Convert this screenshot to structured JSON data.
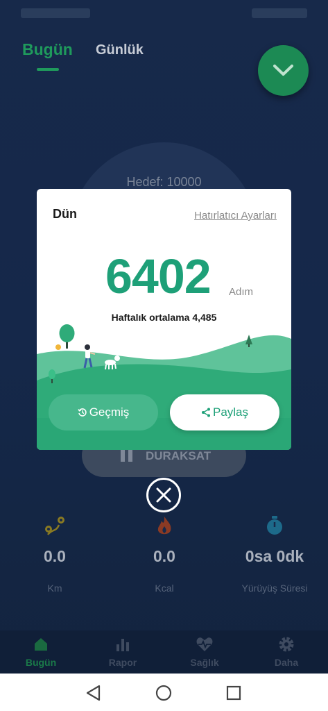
{
  "top_tabs": {
    "today": "Bugün",
    "daily": "Günlük"
  },
  "goal": {
    "label": "Hedef: 10000"
  },
  "pause": {
    "label": "DURAKSAT"
  },
  "stats": [
    {
      "value": "0.0",
      "label": "Km",
      "icon": "route-icon"
    },
    {
      "value": "0.0",
      "label": "Kcal",
      "icon": "flame-icon"
    },
    {
      "value": "0sa 0dk",
      "label": "Yürüyüş Süresi",
      "icon": "stopwatch-icon"
    }
  ],
  "bottom_nav": [
    {
      "label": "Bugün",
      "icon": "home-icon",
      "active": true
    },
    {
      "label": "Rapor",
      "icon": "bar-chart-icon",
      "active": false
    },
    {
      "label": "Sağlık",
      "icon": "heart-pulse-icon",
      "active": false
    },
    {
      "label": "Daha",
      "icon": "gear-icon",
      "active": false
    }
  ],
  "modal": {
    "title": "Dün",
    "reminder_link": "Hatırlatıcı Ayarları",
    "steps": "6402",
    "steps_unit": "Adım",
    "weekly_average": "Haftalık ortalama 4,485",
    "history_button": "Geçmiş",
    "share_button": "Paylaş"
  },
  "colors": {
    "accent": "#1ea078",
    "background": "#15284a",
    "history_button": "#47b78c"
  }
}
